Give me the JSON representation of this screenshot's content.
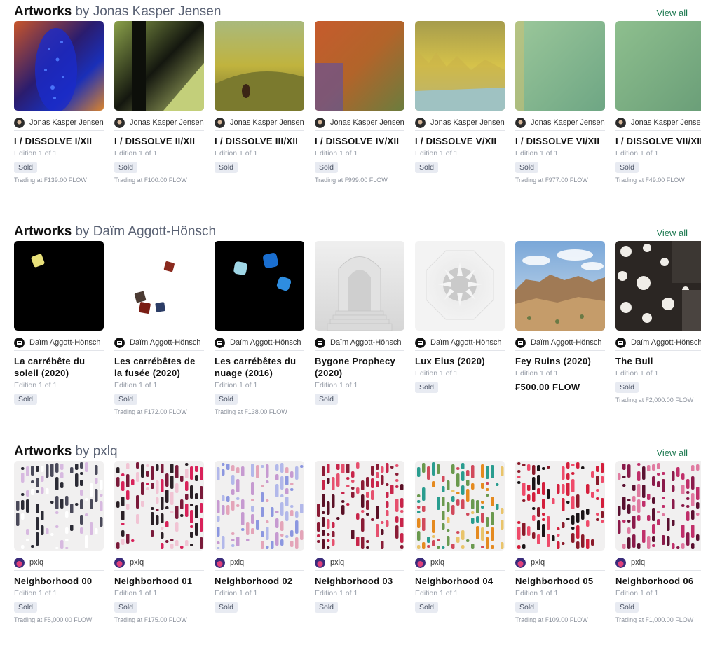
{
  "sections": [
    {
      "title": "Artworks",
      "by": "by Jonas Kasper Jensen",
      "view_all": "View all",
      "cards": [
        {
          "creator": "Jonas Kasper Jensen",
          "title": "I / DISSOLVE I/XII",
          "edition": "Edition 1 of 1",
          "badge": "Sold",
          "trading": "Trading at ₣139.00 FLOW"
        },
        {
          "creator": "Jonas Kasper Jensen",
          "title": "I / DISSOLVE II/XII",
          "edition": "Edition 1 of 1",
          "badge": "Sold",
          "trading": "Trading at ₣100.00 FLOW"
        },
        {
          "creator": "Jonas Kasper Jensen",
          "title": "I / DISSOLVE III/XII",
          "edition": "Edition 1 of 1",
          "badge": "Sold",
          "trading": ""
        },
        {
          "creator": "Jonas Kasper Jensen",
          "title": "I / DISSOLVE IV/XII",
          "edition": "Edition 1 of 1",
          "badge": "Sold",
          "trading": "Trading at ₣999.00 FLOW"
        },
        {
          "creator": "Jonas Kasper Jensen",
          "title": "I / DISSOLVE V/XII",
          "edition": "Edition 1 of 1",
          "badge": "Sold",
          "trading": ""
        },
        {
          "creator": "Jonas Kasper Jensen",
          "title": "I / DISSOLVE VI/XII",
          "edition": "Edition 1 of 1",
          "badge": "Sold",
          "trading": "Trading at ₣977.00 FLOW"
        },
        {
          "creator": "Jonas Kasper Jensen",
          "title": "I / DISSOLVE VII/XII",
          "edition": "Edition 1 of 1",
          "badge": "Sold",
          "trading": "Trading at ₣49.00 FLOW"
        }
      ]
    },
    {
      "title": "Artworks",
      "by": "by Daïm Aggott-Hönsch",
      "view_all": "View all",
      "cards": [
        {
          "creator": "Daïm Aggott-Hönsch",
          "title": "La carrébête du soleil (2020)",
          "edition": "Edition 1 of 1",
          "badge": "Sold",
          "trading": ""
        },
        {
          "creator": "Daïm Aggott-Hönsch",
          "title": "Les carrébêtes de la fusée (2020)",
          "edition": "Edition 1 of 1",
          "badge": "Sold",
          "trading": "Trading at ₣172.00 FLOW"
        },
        {
          "creator": "Daïm Aggott-Hönsch",
          "title": "Les carrébêtes du nuage (2016)",
          "edition": "Edition 1 of 1",
          "badge": "Sold",
          "trading": "Trading at ₣138.00 FLOW"
        },
        {
          "creator": "Daïm Aggott-Hönsch",
          "title": "Bygone Prophecy (2020)",
          "edition": "Edition 1 of 1",
          "badge": "Sold",
          "trading": ""
        },
        {
          "creator": "Daïm Aggott-Hönsch",
          "title": "Lux Eius (2020)",
          "edition": "Edition 1 of 1",
          "badge": "Sold",
          "trading": ""
        },
        {
          "creator": "Daïm Aggott-Hönsch",
          "title": "Fey Ruins (2020)",
          "edition": "Edition 1 of 1",
          "price": "₣500.00 FLOW"
        },
        {
          "creator": "Daïm Aggott-Hönsch",
          "title": "The Bull",
          "edition": "Edition 1 of 1",
          "badge": "Sold",
          "trading": "Trading at ₣2,000.00 FLOW"
        }
      ]
    },
    {
      "title": "Artworks",
      "by": "by pxlq",
      "view_all": "View all",
      "cards": [
        {
          "creator": "pxlq",
          "title": "Neighborhood 00",
          "edition": "Edition 1 of 1",
          "badge": "Sold",
          "trading": "Trading at ₣5,000.00 FLOW"
        },
        {
          "creator": "pxlq",
          "title": "Neighborhood 01",
          "edition": "Edition 1 of 1",
          "badge": "Sold",
          "trading": "Trading at ₣175.00 FLOW"
        },
        {
          "creator": "pxlq",
          "title": "Neighborhood 02",
          "edition": "Edition 1 of 1",
          "badge": "Sold",
          "trading": ""
        },
        {
          "creator": "pxlq",
          "title": "Neighborhood 03",
          "edition": "Edition 1 of 1",
          "badge": "Sold",
          "trading": ""
        },
        {
          "creator": "pxlq",
          "title": "Neighborhood 04",
          "edition": "Edition 1 of 1",
          "badge": "Sold",
          "trading": ""
        },
        {
          "creator": "pxlq",
          "title": "Neighborhood 05",
          "edition": "Edition 1 of 1",
          "badge": "Sold",
          "trading": "Trading at ₣109.00 FLOW"
        },
        {
          "creator": "pxlq",
          "title": "Neighborhood 06",
          "edition": "Edition 1 of 1",
          "badge": "Sold",
          "trading": "Trading at ₣1,000.00 FLOW"
        }
      ]
    }
  ]
}
